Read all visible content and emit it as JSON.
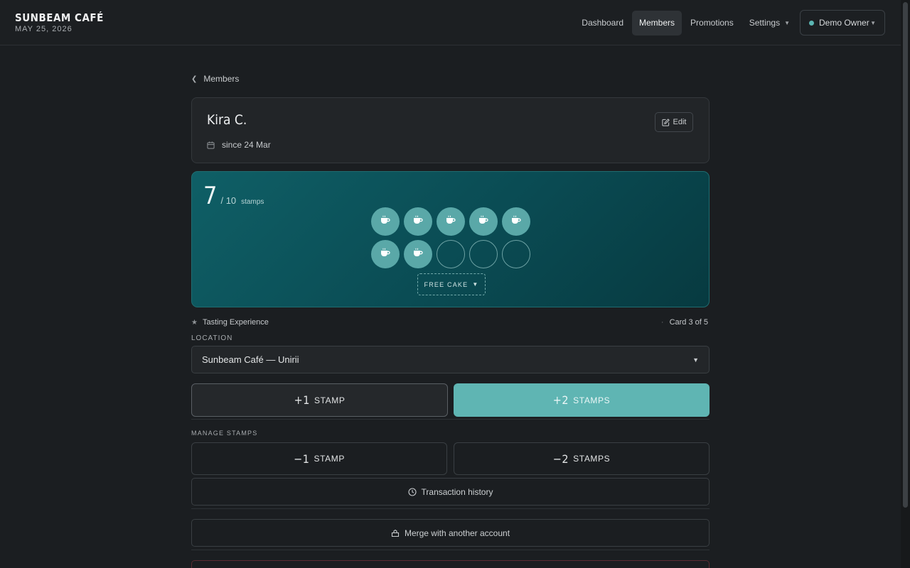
{
  "brand": {
    "name": "SUNBEAM CAFÉ",
    "date": "MAY 25, 2026"
  },
  "nav": {
    "items": [
      {
        "label": "Dashboard",
        "active": false
      },
      {
        "label": "Members",
        "active": true
      },
      {
        "label": "Promotions",
        "active": false
      },
      {
        "label": "Settings",
        "active": false
      }
    ],
    "owner": "Demo Owner"
  },
  "breadcrumb": {
    "label": "Members"
  },
  "member": {
    "name": "Kira C.",
    "since": "since 24 Mar",
    "edit_label": "Edit"
  },
  "stamps": {
    "count": "7",
    "total": "/ 10",
    "unit": "stamps",
    "filled": 7,
    "capacity": 10,
    "reward": "FREE CAKE"
  },
  "meta": {
    "program": "Tasting Experience",
    "card": "Card 3 of 5"
  },
  "location": {
    "label": "LOCATION",
    "value": "Sunbeam Café — Unirii"
  },
  "actions": {
    "add1": {
      "num": "+1",
      "label": "STAMP"
    },
    "add2": {
      "num": "+2",
      "label": "STAMPS"
    },
    "manage_label": "MANAGE STAMPS",
    "rm1": {
      "num": "−1",
      "label": "STAMP"
    },
    "rm2": {
      "num": "−2",
      "label": "STAMPS"
    },
    "history": "Transaction history",
    "merge": "Merge with another account"
  },
  "colors": {
    "accent": "#5fb5b3",
    "card_bg": "#0f5f66"
  }
}
